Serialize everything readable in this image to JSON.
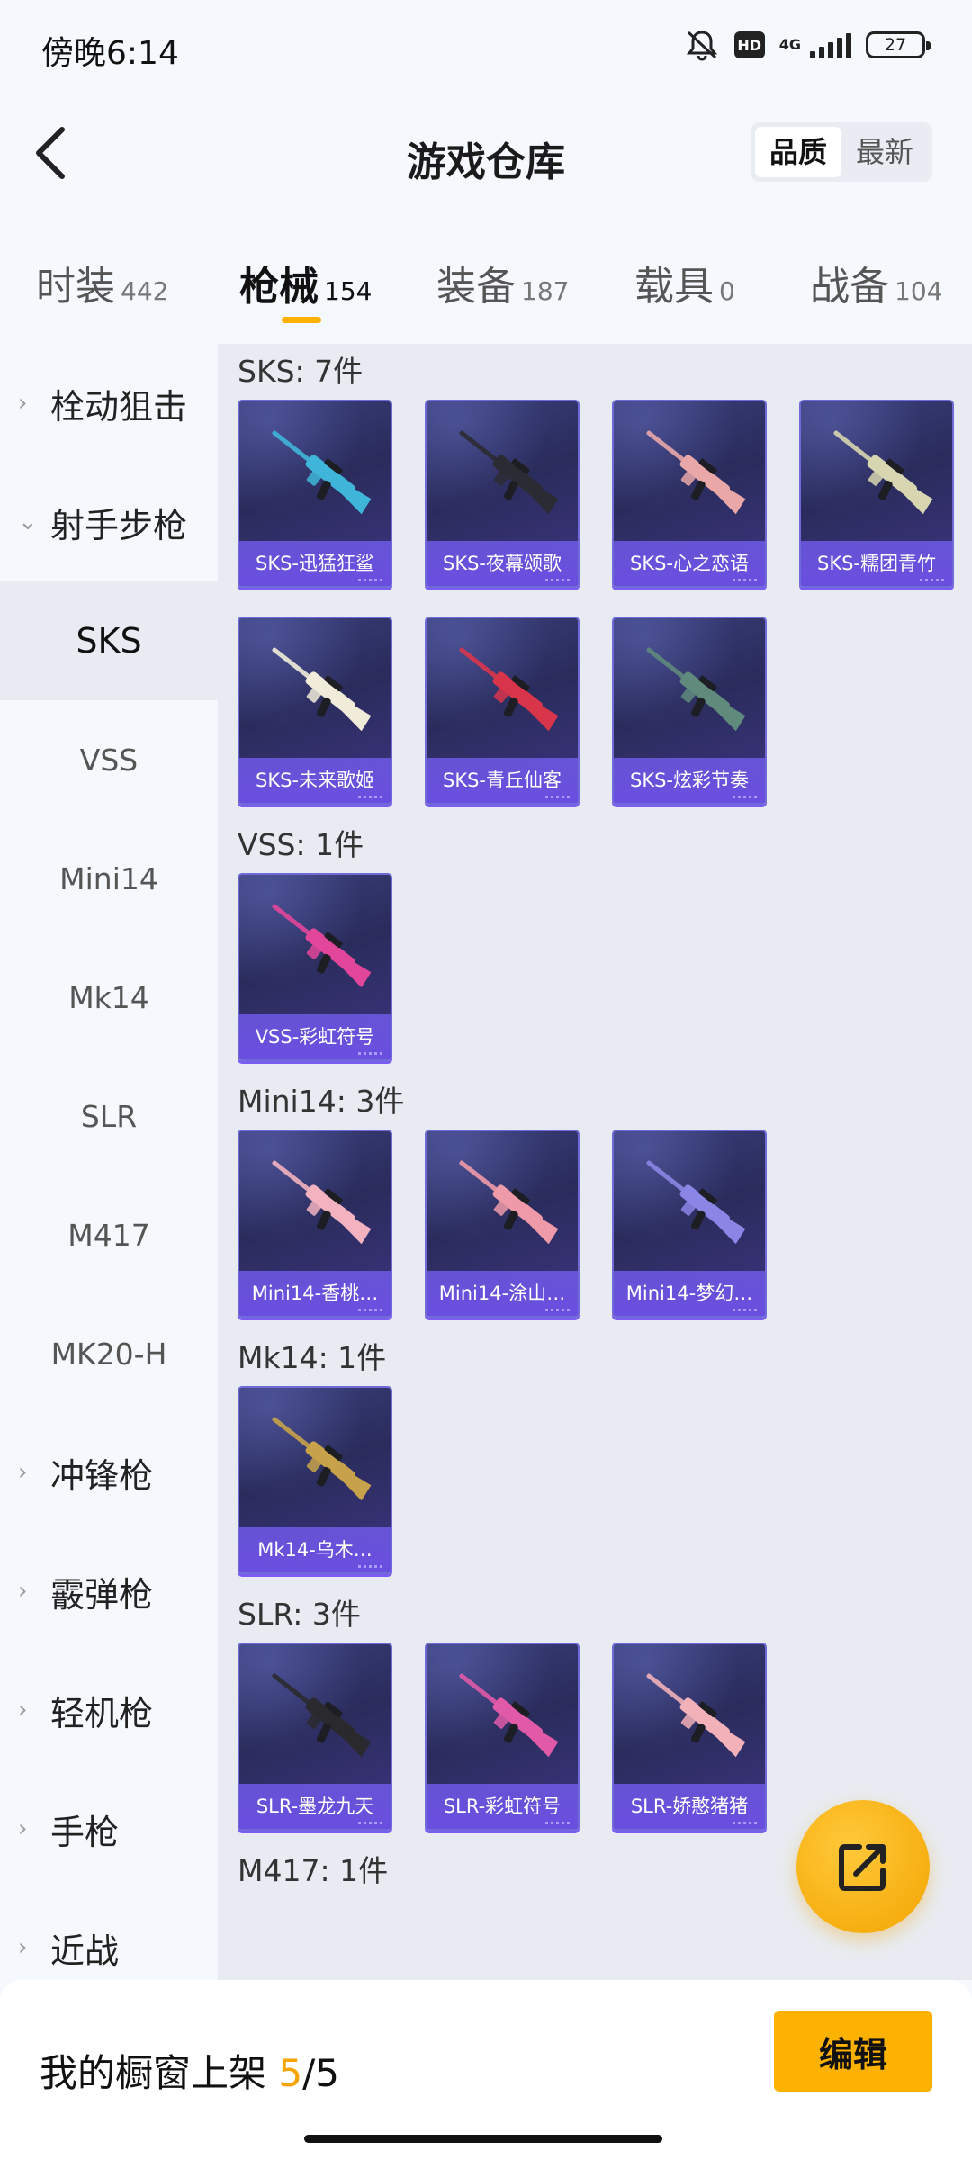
{
  "status_bar": {
    "time": "傍晚6:14",
    "hd": "HD",
    "network": "4G",
    "battery": "27"
  },
  "header": {
    "title": "游戏仓库",
    "sort_options": [
      "品质",
      "最新"
    ],
    "active_sort": "品质"
  },
  "tabs": [
    {
      "label": "时装",
      "count": "442"
    },
    {
      "label": "枪械",
      "count": "154",
      "active": true
    },
    {
      "label": "装备",
      "count": "187"
    },
    {
      "label": "载具",
      "count": "0"
    },
    {
      "label": "战备",
      "count": "104"
    }
  ],
  "sidebar": {
    "items": [
      {
        "label": "栓动狙击",
        "type": "category",
        "expanded": false
      },
      {
        "label": "射手步枪",
        "type": "category",
        "expanded": true
      },
      {
        "label": "SKS",
        "type": "sub",
        "active": true
      },
      {
        "label": "VSS",
        "type": "sub"
      },
      {
        "label": "Mini14",
        "type": "sub"
      },
      {
        "label": "Mk14",
        "type": "sub"
      },
      {
        "label": "SLR",
        "type": "sub"
      },
      {
        "label": "M417",
        "type": "sub"
      },
      {
        "label": "MK20-H",
        "type": "sub"
      },
      {
        "label": "冲锋枪",
        "type": "category",
        "expanded": false
      },
      {
        "label": "霰弹枪",
        "type": "category",
        "expanded": false
      },
      {
        "label": "轻机枪",
        "type": "category",
        "expanded": false
      },
      {
        "label": "手枪",
        "type": "category",
        "expanded": false
      },
      {
        "label": "近战",
        "type": "category",
        "expanded": false
      }
    ]
  },
  "groups": [
    {
      "title": "SKS: 7件",
      "items": [
        {
          "name": "SKS-迅猛狂鲨",
          "color": "#3fb6d9"
        },
        {
          "name": "SKS-夜幕颂歌",
          "color": "#2b2b33"
        },
        {
          "name": "SKS-心之恋语",
          "color": "#e9a7a8"
        },
        {
          "name": "SKS-糯团青竹",
          "color": "#d8d6b0"
        },
        {
          "name": "SKS-未来歌姬",
          "color": "#f1ecd9"
        },
        {
          "name": "SKS-青丘仙客",
          "color": "#d8354a"
        },
        {
          "name": "SKS-炫彩节奏",
          "color": "#5f8a7c"
        }
      ]
    },
    {
      "title": "VSS: 1件",
      "items": [
        {
          "name": "VSS-彩虹符号",
          "color": "#e2469a"
        }
      ]
    },
    {
      "title": "Mini14: 3件",
      "items": [
        {
          "name": "Mini14-香桃…",
          "color": "#f2b2c0"
        },
        {
          "name": "Mini14-涂山…",
          "color": "#ef9aa8"
        },
        {
          "name": "Mini14-梦幻…",
          "color": "#8b86e6"
        }
      ]
    },
    {
      "title": "Mk14: 1件",
      "items": [
        {
          "name": "Mk14-乌木…",
          "color": "#c7a24a"
        }
      ]
    },
    {
      "title": "SLR: 3件",
      "items": [
        {
          "name": "SLR-墨龙九天",
          "color": "#2a2a2e"
        },
        {
          "name": "SLR-彩虹符号",
          "color": "#e05aa8"
        },
        {
          "name": "SLR-娇憨猪猪",
          "color": "#f2b0b9"
        }
      ]
    },
    {
      "title": "M417: 1件",
      "items": []
    }
  ],
  "bottom_bar": {
    "label": "我的橱窗上架",
    "current": "5",
    "total": "/5",
    "edit_label": "编辑"
  },
  "icons": {
    "back": "back-chevron-icon",
    "fab": "share-external-icon",
    "mute": "mute-bell-icon"
  }
}
